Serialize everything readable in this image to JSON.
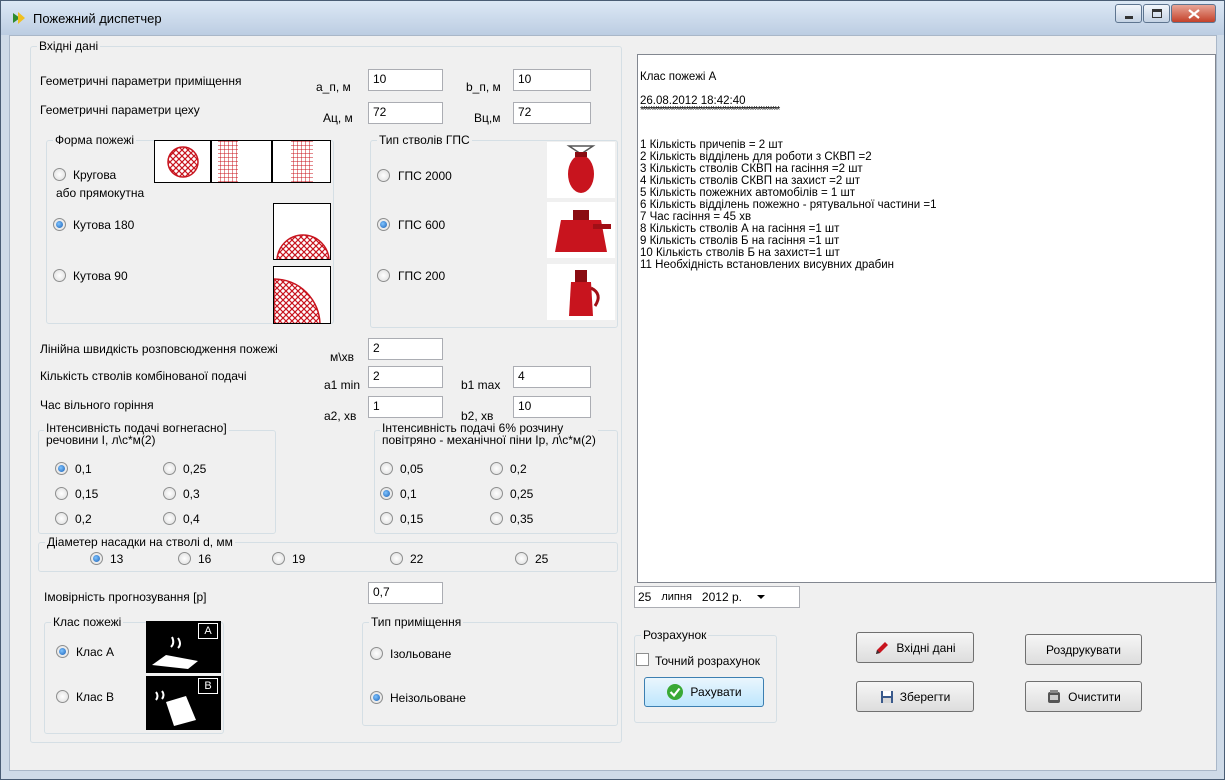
{
  "window": {
    "title": "Пожежний диспетчер"
  },
  "input_group": {
    "legend": "Вхідні дані",
    "room_params": {
      "label": "Геометричні параметри приміщення",
      "a_label": "a_п, м",
      "a_value": "10",
      "b_label": "b_п, м",
      "b_value": "10"
    },
    "workshop_params": {
      "label": "Геометричні параметри цеху",
      "a_label": "Ац, м",
      "a_value": "72",
      "b_label": "Вц,м",
      "b_value": "72"
    },
    "fire_shape": {
      "legend": "Форма пожежі",
      "options": [
        {
          "label": "Кругова",
          "label2": "або прямокутна",
          "selected": false
        },
        {
          "label": "Кутова 180",
          "selected": true
        },
        {
          "label": "Кутова 90",
          "selected": false
        }
      ]
    },
    "nozzle_type": {
      "legend": "Тип стволів ГПС",
      "options": [
        {
          "label": "ГПС 2000",
          "selected": false
        },
        {
          "label": "ГПС 600",
          "selected": true
        },
        {
          "label": "ГПС 200",
          "selected": false
        }
      ]
    },
    "spread_speed": {
      "label": "Лінійна швидкість розповсюдження пожежі",
      "unit": "м\\хв",
      "value": "2"
    },
    "combined_nozzles": {
      "label": "Кількість стволів комбінованої  подачі",
      "min_label": "a1 min",
      "min_value": "2",
      "max_label": "b1 max",
      "max_value": "4"
    },
    "free_burning": {
      "label": "Час вільного горіння",
      "a_label": "a2, хв",
      "a_value": "1",
      "b_label": "b2, хв",
      "b_value": "10"
    },
    "intensity_agent": {
      "legend_line1": "Інтенсивність подачі вогнегасно]",
      "legend_line2": "речовини  I, л\\с*м(2)",
      "options": [
        {
          "label": "0,1",
          "selected": true
        },
        {
          "label": "0,25",
          "selected": false
        },
        {
          "label": "0,15",
          "selected": false
        },
        {
          "label": "0,3",
          "selected": false
        },
        {
          "label": "0,2",
          "selected": false
        },
        {
          "label": "0,4",
          "selected": false
        }
      ]
    },
    "intensity_foam": {
      "legend_line1": "Інтенсивність подачі 6% розчину",
      "legend_line2": "повітряно - механічної піни Iр, л\\с*м(2)",
      "options": [
        {
          "label": "0,05",
          "selected": false
        },
        {
          "label": "0,2",
          "selected": false
        },
        {
          "label": "0,1",
          "selected": true
        },
        {
          "label": "0,25",
          "selected": false
        },
        {
          "label": "0,15",
          "selected": false
        },
        {
          "label": "0,35",
          "selected": false
        }
      ]
    },
    "nozzle_diameter": {
      "legend": "Діаметер насадки на стволі d, мм",
      "options": [
        {
          "label": "13",
          "selected": true
        },
        {
          "label": "16",
          "selected": false
        },
        {
          "label": "19",
          "selected": false
        },
        {
          "label": "22",
          "selected": false
        },
        {
          "label": "25",
          "selected": false
        }
      ]
    },
    "probability": {
      "label": "Імовірність прогнозування [р]",
      "value": "0,7"
    },
    "fire_class": {
      "legend": "Клас пожежі",
      "options": [
        {
          "label": "Клас А",
          "selected": true
        },
        {
          "label": "Клас В",
          "selected": false
        }
      ],
      "icon_a_letter": "А",
      "icon_b_letter": "В"
    },
    "room_type": {
      "legend": "Тип приміщення",
      "options": [
        {
          "label": "Ізольоване",
          "selected": false
        },
        {
          "label": "Неізольоване",
          "selected": true
        }
      ]
    }
  },
  "output": {
    "lines": [
      "Клас пожежі А",
      "",
      "26.08.2012 18:42:40",
      "**********************************************************",
      "",
      "",
      "1 Кількість причепів = 2 шт",
      "2 Кількість відділень для роботи з СКВП =2",
      "3 Кількість стволів СКВП на гасіння =2 шт",
      "4 Кількість стволів СКВП на захист =2 шт",
      "5 Кількість пожежних автомобілів = 1 шт",
      "6 Кількість відділень пожежно - рятувальної частини =1",
      "7 Час гасіння = 45 хв",
      "8 Кількість стволів А на гасіння =1 шт",
      "9 Кількість стволів Б на гасіння =1 шт",
      "10 Кількість стволів Б на захист=1 шт",
      "11 Необхідність встановлених висувних драбин"
    ]
  },
  "date_picker": {
    "day": "25",
    "month": "липня",
    "year": "2012 р."
  },
  "calc_group": {
    "legend": "Розрахунок",
    "exact_label": "Точний розрахунок",
    "exact_checked": false,
    "calculate_label": "Рахувати"
  },
  "buttons": {
    "input_data": "Вхідні дані",
    "print": "Роздрукувати",
    "save": "Зберегти",
    "clear": "Очистити"
  },
  "colors": {
    "accent": "#1a5fb4",
    "fire_red": "#c8141e",
    "window_frame": "#cfdbe8"
  }
}
